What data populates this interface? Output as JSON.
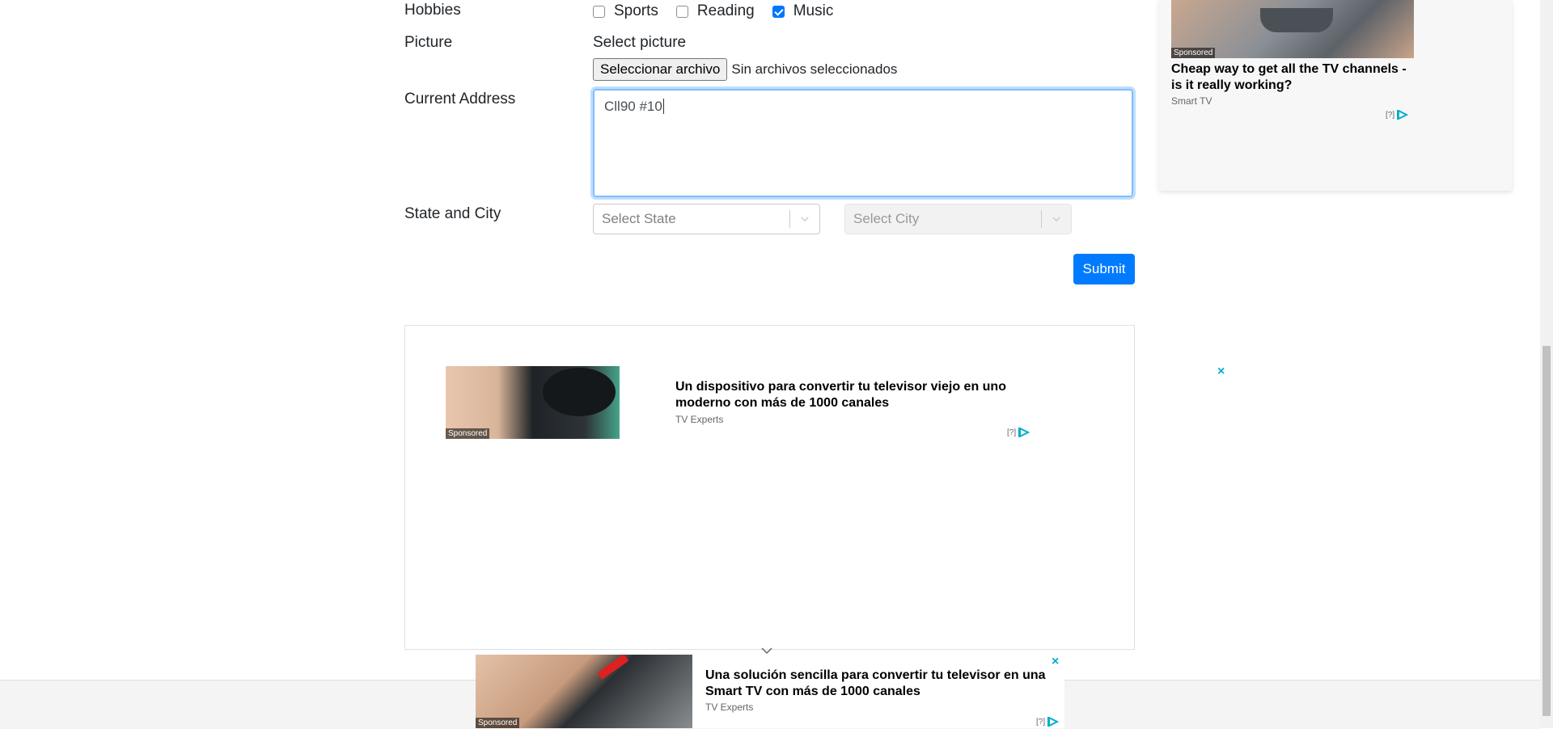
{
  "form": {
    "hobbies_label": "Hobbies",
    "hobbies": [
      {
        "label": "Sports",
        "checked": false
      },
      {
        "label": "Reading",
        "checked": false
      },
      {
        "label": "Music",
        "checked": true
      }
    ],
    "picture_label": "Picture",
    "picture_text": "Select picture",
    "file_button": "Seleccionar archivo",
    "file_status": "Sin archivos seleccionados",
    "address_label": "Current Address",
    "address_value": "Cll90 #10",
    "state_city_label": "State and City",
    "state_placeholder": "Select State",
    "city_placeholder": "Select City",
    "submit": "Submit"
  },
  "side_ad": {
    "sponsored": "Sponsored",
    "title": "Cheap way to get all the TV channels - is it really working?",
    "source": "Smart TV",
    "adchoice": "[?]"
  },
  "main_ad": {
    "sponsored": "Sponsored",
    "title": "Un dispositivo para convertir tu televisor viejo en uno moderno con más de 1000 canales",
    "source": "TV Experts",
    "adchoice": "[?]",
    "close": "×"
  },
  "bottom_ad": {
    "sponsored": "Sponsored",
    "title": "Una solución sencilla para convertir tu televisor en una Smart TV con más de 1000 canales",
    "source": "TV Experts",
    "adchoice": "[?]",
    "close": "×"
  },
  "colors": {
    "primary": "#007bff",
    "close": "#00aecd"
  }
}
